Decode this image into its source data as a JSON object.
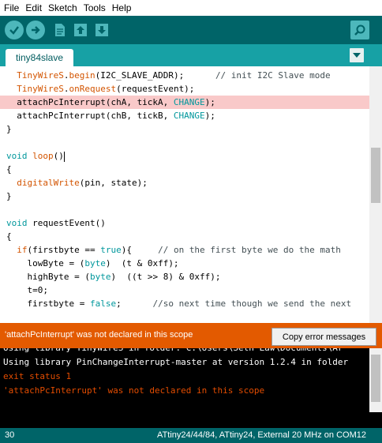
{
  "menu": [
    "File",
    "Edit",
    "Sketch",
    "Tools",
    "Help"
  ],
  "toolbar": {
    "verify": "verify-icon",
    "upload": "upload-arrow-icon",
    "new": "new-file-icon",
    "open": "open-icon",
    "save": "save-icon",
    "serial_monitor": "magnifier-icon"
  },
  "tab": {
    "active": "tiny84slave"
  },
  "editor": {
    "lines": [
      [
        {
          "t": "  "
        },
        {
          "t": "TinyWireS",
          "c": "kw-or"
        },
        {
          "t": "."
        },
        {
          "t": "begin",
          "c": "kw-or"
        },
        {
          "t": "(I2C_SLAVE_ADDR);      "
        },
        {
          "t": "// init I2C Slave mode",
          "c": "cm"
        }
      ],
      [
        {
          "t": "  "
        },
        {
          "t": "TinyWireS",
          "c": "kw-or"
        },
        {
          "t": "."
        },
        {
          "t": "onRequest",
          "c": "kw-or"
        },
        {
          "t": "(requestEvent);"
        }
      ],
      [
        {
          "t": "  attachPcInterrupt(chA, tickA, "
        },
        {
          "t": "CHANGE",
          "c": "kw-bl"
        },
        {
          "t": ");"
        }
      ],
      [
        {
          "t": "  attachPcInterrupt(chB, tickB, "
        },
        {
          "t": "CHANGE",
          "c": "kw-bl"
        },
        {
          "t": ");"
        }
      ],
      [
        {
          "t": "}"
        }
      ],
      [
        {
          "t": ""
        }
      ],
      [
        {
          "t": "void",
          "c": "kw-ty"
        },
        {
          "t": " "
        },
        {
          "t": "loop",
          "c": "kw-or"
        },
        {
          "t": "()"
        }
      ],
      [
        {
          "t": "{"
        }
      ],
      [
        {
          "t": "  "
        },
        {
          "t": "digitalWrite",
          "c": "kw-or"
        },
        {
          "t": "(pin, state);"
        }
      ],
      [
        {
          "t": "}"
        }
      ],
      [
        {
          "t": ""
        }
      ],
      [
        {
          "t": "void",
          "c": "kw-ty"
        },
        {
          "t": " requestEvent()"
        }
      ],
      [
        {
          "t": "{"
        }
      ],
      [
        {
          "t": "  "
        },
        {
          "t": "if",
          "c": "kw-or"
        },
        {
          "t": "(firstbyte == "
        },
        {
          "t": "true",
          "c": "kw-bl"
        },
        {
          "t": "){     "
        },
        {
          "t": "// on the first byte we do the math",
          "c": "cm"
        }
      ],
      [
        {
          "t": "    lowByte = ("
        },
        {
          "t": "byte",
          "c": "kw-ty"
        },
        {
          "t": ")  (t & 0xff);"
        }
      ],
      [
        {
          "t": "    highByte = ("
        },
        {
          "t": "byte",
          "c": "kw-ty"
        },
        {
          "t": ")  ((t >> 8) & 0xff);"
        }
      ],
      [
        {
          "t": "    t=0;"
        }
      ],
      [
        {
          "t": "    firstbyte = "
        },
        {
          "t": "false",
          "c": "kw-bl"
        },
        {
          "t": ";      "
        },
        {
          "t": "//so next time though we send the next",
          "c": "cm"
        }
      ]
    ],
    "highlight_line": 2,
    "cursor_line": 6
  },
  "error_bar": {
    "message": "'attachPcInterrupt' was not declared in this scope",
    "copy_button": "Copy error messages"
  },
  "console": {
    "lines": [
      {
        "text": "Using library TinyWireS in folder: C:\\Users\\Seth Law\\Documents\\Ar",
        "color": "#ffffff"
      },
      {
        "text": "Using library PinChangeInterrupt-master at version 1.2.4 in folder",
        "color": "#ffffff"
      },
      {
        "text": "exit status 1",
        "color": "#e34c00"
      },
      {
        "text": "'attachPcInterrupt' was not declared in this scope",
        "color": "#e34c00"
      }
    ]
  },
  "status": {
    "line_number": "30",
    "board": "ATtiny24/44/84, ATtiny24, External 20 MHz on COM12"
  }
}
